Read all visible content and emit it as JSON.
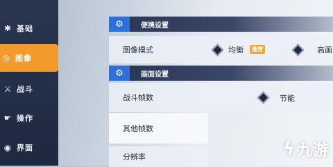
{
  "sidebar": {
    "items": [
      {
        "label": "基础",
        "icon": "gear-icon",
        "glyph": "✱"
      },
      {
        "label": "图像",
        "icon": "image-icon",
        "glyph": "◎"
      },
      {
        "label": "战斗",
        "icon": "sword-icon",
        "glyph": "⚔"
      },
      {
        "label": "操作",
        "icon": "hand-icon",
        "glyph": "☛"
      },
      {
        "label": "界面",
        "icon": "screen-icon",
        "glyph": "◉"
      }
    ],
    "active_index": 1
  },
  "sections": [
    {
      "title": "便携设置"
    },
    {
      "title": "画面设置"
    }
  ],
  "rows": {
    "image_mode": {
      "label": "图像模式",
      "option1": "均衡",
      "badge": "推荐",
      "option2": "高画"
    },
    "battle_fps": {
      "label": "战斗帧数",
      "option1": "节能"
    },
    "other_fps": {
      "label": "其他帧数"
    },
    "resolution": {
      "label": "分辨率"
    }
  },
  "watermark": {
    "text": "九游",
    "icon": "jiuyou-logo-icon"
  },
  "colors": {
    "accent": "#f29a2c",
    "header_icon_bg": "#2f6fd8",
    "sidebar_bg": "#1e2940"
  }
}
